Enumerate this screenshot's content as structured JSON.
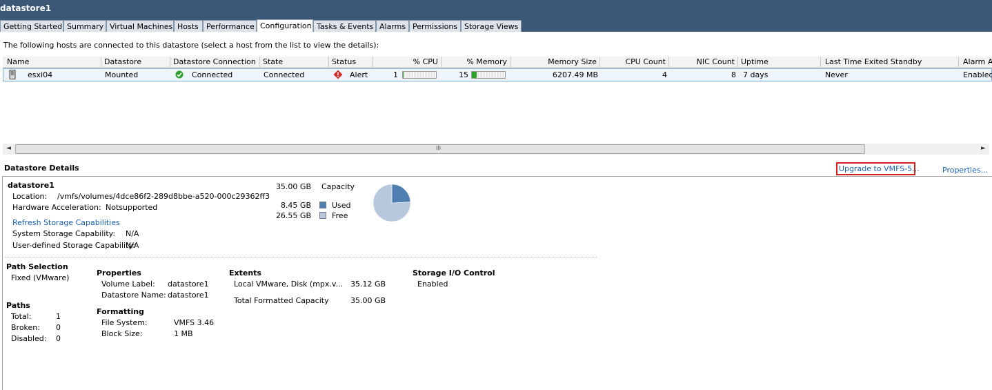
{
  "window": {
    "title": "datastore1"
  },
  "tabs": [
    {
      "label": "Getting Started"
    },
    {
      "label": "Summary"
    },
    {
      "label": "Virtual Machines"
    },
    {
      "label": "Hosts"
    },
    {
      "label": "Performance"
    },
    {
      "label": "Configuration",
      "active": true
    },
    {
      "label": "Tasks & Events"
    },
    {
      "label": "Alarms"
    },
    {
      "label": "Permissions"
    },
    {
      "label": "Storage Views"
    }
  ],
  "intro_text": "The following hosts are connected to this datastore (select a host from the list to view the details):",
  "hosts_table": {
    "columns": [
      "Name",
      "Datastore",
      "Datastore Connection",
      "State",
      "Status",
      "% CPU",
      "% Memory",
      "Memory Size",
      "CPU Count",
      "NIC Count",
      "Uptime",
      "Last Time Exited Standby",
      "Alarm A"
    ],
    "rows": [
      {
        "name": "esxi04",
        "datastore": "Mounted",
        "connection": "Connected",
        "state": "Connected",
        "status": "Alert",
        "cpu": "1",
        "cpu_fraction": 0.01,
        "memory": "15",
        "memory_fraction": 0.15,
        "memory_size": "6207.49 MB",
        "cpu_count": "4",
        "nic_count": "8",
        "uptime": "7 days",
        "last_standby": "Never",
        "alarm": "Enabled"
      }
    ]
  },
  "scrollbar": {
    "grip": "III"
  },
  "datastore_details": {
    "header": "Datastore Details",
    "upgrade_link": "Upgrade to VMFS-5...",
    "properties_link": "Properties...",
    "name": "datastore1",
    "location_label": "Location:",
    "location_value": "/vmfs/volumes/4dce86f2-289d8bbe-a520-000c29362ff3",
    "hw_accel_label": "Hardware Acceleration:",
    "hw_accel_value": "Notsupported",
    "refresh_link": "Refresh Storage Capabilities",
    "system_cap_label": "System Storage Capability:",
    "system_cap_value": "N/A",
    "user_cap_label": "User-defined Storage Capability:",
    "user_cap_value": "N/A",
    "capacity": {
      "total": "35.00 GB",
      "total_label": "Capacity",
      "used": "8.45 GB",
      "used_label": "Used",
      "free": "26.55 GB",
      "free_label": "Free",
      "used_color": "#4f7fb1",
      "free_color": "#b7c8dd"
    },
    "path_selection": {
      "title": "Path Selection",
      "value": "Fixed (VMware)"
    },
    "paths": {
      "title": "Paths",
      "total_label": "Total:",
      "total": "1",
      "broken_label": "Broken:",
      "broken": "0",
      "disabled_label": "Disabled:",
      "disabled": "0"
    },
    "properties": {
      "title": "Properties",
      "volume_label_label": "Volume Label:",
      "volume_label": "datastore1",
      "ds_name_label": "Datastore Name:",
      "ds_name": "datastore1"
    },
    "formatting": {
      "title": "Formatting",
      "fs_label": "File System:",
      "fs": "VMFS 3.46",
      "block_label": "Block Size:",
      "block": "1 MB"
    },
    "extents": {
      "title": "Extents",
      "disk_label": "Local VMware, Disk (mpx.v...",
      "disk_size": "35.12 GB",
      "total_label": "Total Formatted Capacity",
      "total": "35.00 GB"
    },
    "sioc": {
      "title": "Storage I/O Control",
      "value": "Enabled"
    }
  },
  "chart_data": {
    "type": "pie",
    "categories": [
      "Used",
      "Free"
    ],
    "values": [
      8.45,
      26.55
    ],
    "colors": [
      "#4f7fb1",
      "#b7c8dd"
    ]
  }
}
